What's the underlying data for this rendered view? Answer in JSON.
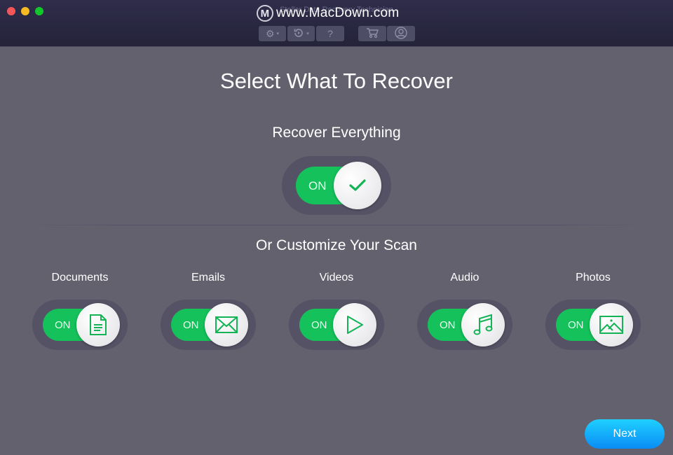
{
  "window": {
    "title": "Stellar Data Recovery Technician",
    "watermark": "www.MacDown.com",
    "watermark_logo": "M"
  },
  "toolbar": {
    "buttons": [
      {
        "name": "settings",
        "icon": "gear-icon",
        "glyph": "⚙",
        "has_dropdown": true
      },
      {
        "name": "resume-recovery",
        "icon": "history-icon",
        "glyph": "⟲",
        "has_dropdown": true
      },
      {
        "name": "help",
        "icon": "help-icon",
        "glyph": "?",
        "has_dropdown": false
      },
      {
        "name": "cart",
        "icon": "cart-icon",
        "has_dropdown": false
      },
      {
        "name": "account",
        "icon": "user-icon",
        "has_dropdown": false
      }
    ],
    "dropdown_glyph": "▾"
  },
  "main": {
    "title": "Select What To Recover",
    "recover_everything": {
      "label": "Recover Everything",
      "state": "ON",
      "checked": true
    },
    "customize_label": "Or Customize Your Scan",
    "categories": [
      {
        "label": "Documents",
        "state": "ON",
        "icon": "document-icon"
      },
      {
        "label": "Emails",
        "state": "ON",
        "icon": "email-icon"
      },
      {
        "label": "Videos",
        "state": "ON",
        "icon": "video-play-icon"
      },
      {
        "label": "Audio",
        "state": "ON",
        "icon": "music-note-icon"
      },
      {
        "label": "Photos",
        "state": "ON",
        "icon": "photo-icon"
      }
    ]
  },
  "footer": {
    "next_label": "Next"
  },
  "colors": {
    "accent_green": "#14c15a",
    "next_blue": "#0a8cf5",
    "background": "#63616e"
  }
}
